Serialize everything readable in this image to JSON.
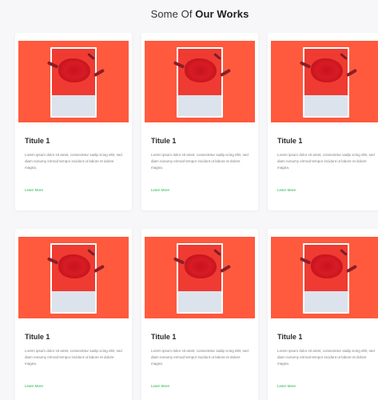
{
  "section": {
    "heading_prefix": "Some Of ",
    "heading_strong": "Our Works"
  },
  "colors": {
    "thumbnail_bg": "#ff5a3e",
    "link": "#22b14c",
    "card_bg": "#ffffff",
    "page_bg": "#f7f7f9"
  },
  "cards": [
    {
      "title": "Titule 1",
      "text": "Lorem ipsum dolor sit amet, consectetur sadip scing elitr, sed diam nonumy eirmod tempor incidunt ut labore et dolore magna.",
      "link": "Learn More"
    },
    {
      "title": "Titule 1",
      "text": "Lorem ipsum dolor sit amet, consectetur sadip scing elitr, sed diam nonumy eirmod tempor incidunt ut labore et dolore magna.",
      "link": "Learn More"
    },
    {
      "title": "Titule 1",
      "text": "Lorem ipsum dolor sit amet, consectetur sadip scing elitr, sed diam nonumy eirmod tempor incidunt ut labore et dolore magna.",
      "link": "Learn More"
    },
    {
      "title": "Titule 1",
      "text": "Lorem ipsum dolor sit amet, consectetur sadip scing elitr, sed diam nonumy eirmod tempor incidunt ut labore et dolore magna.",
      "link": "Learn More"
    },
    {
      "title": "Titule 1",
      "text": "Lorem ipsum dolor sit amet, consectetur sadip scing elitr, sed diam nonumy eirmod tempor incidunt ut labore et dolore magna.",
      "link": "Learn More"
    },
    {
      "title": "Titule 1",
      "text": "Lorem ipsum dolor sit amet, consectetur sadip scing elitr, sed diam nonumy eirmod tempor incidunt ut labore et dolore magna.",
      "link": "Learn More"
    }
  ]
}
